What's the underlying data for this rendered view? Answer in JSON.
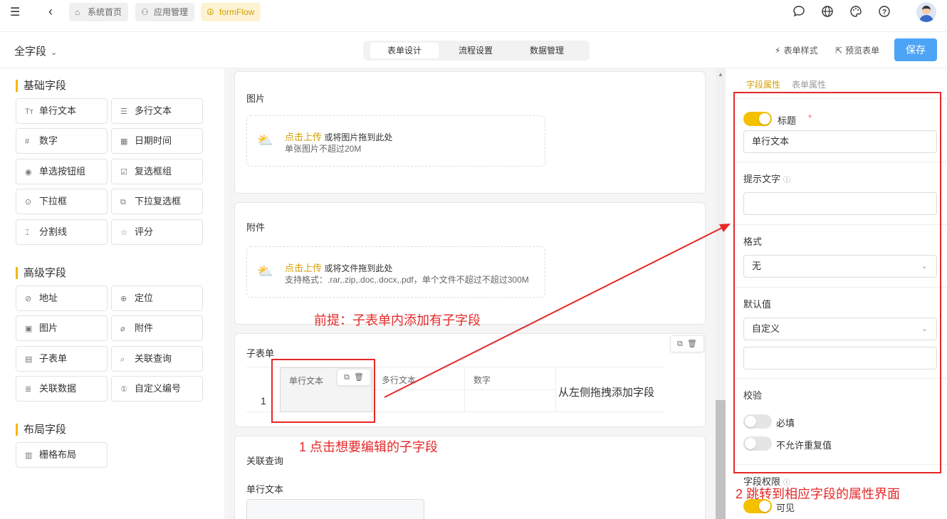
{
  "topbar": {
    "nav": [
      {
        "label": "系统首页",
        "icon": "home-icon",
        "glyph": "⌂"
      },
      {
        "label": "应用管理",
        "icon": "apps-icon",
        "glyph": "⚇"
      },
      {
        "label": "formFlow",
        "icon": "peace-icon",
        "glyph": "☮"
      }
    ],
    "right_icons": [
      "message-icon",
      "globe-icon",
      "palette-icon",
      "help-icon"
    ]
  },
  "subbar": {
    "field_select": "全字段",
    "tabs": [
      "表单设计",
      "流程设置",
      "数据管理"
    ],
    "active_tab": "表单设计",
    "form_style": "表单样式",
    "preview": "预览表单",
    "save": "保存"
  },
  "left": {
    "groups": [
      {
        "title": "基础字段",
        "items": [
          {
            "label": "单行文本",
            "glyph": "Tт"
          },
          {
            "label": "多行文本",
            "glyph": "☰"
          },
          {
            "label": "数字",
            "glyph": "#"
          },
          {
            "label": "日期时间",
            "glyph": "▦"
          },
          {
            "label": "单选按钮组",
            "glyph": "◉"
          },
          {
            "label": "复选框组",
            "glyph": "☑"
          },
          {
            "label": "下拉框",
            "glyph": "⊙"
          },
          {
            "label": "下拉复选框",
            "glyph": "⧉"
          },
          {
            "label": "分割线",
            "glyph": "⌶"
          },
          {
            "label": "评分",
            "glyph": "☆"
          }
        ]
      },
      {
        "title": "高级字段",
        "items": [
          {
            "label": "地址",
            "glyph": "⊘"
          },
          {
            "label": "定位",
            "glyph": "⊕"
          },
          {
            "label": "图片",
            "glyph": "▣"
          },
          {
            "label": "附件",
            "glyph": "⌀"
          },
          {
            "label": "子表单",
            "glyph": "▤"
          },
          {
            "label": "关联查询",
            "glyph": "⌕"
          },
          {
            "label": "关联数据",
            "glyph": "≣"
          },
          {
            "label": "自定义编号",
            "glyph": "①"
          }
        ]
      },
      {
        "title": "布局字段",
        "items": [
          {
            "label": "栅格布局",
            "glyph": "▥"
          }
        ]
      }
    ]
  },
  "canvas": {
    "image_card": {
      "label": "图片",
      "upload_link": "点击上传",
      "upload_text": "或将图片拖到此处",
      "limit": "单张图片不超过20M"
    },
    "attach_card": {
      "label": "附件",
      "upload_link": "点击上传",
      "upload_text": "或将文件拖到此处",
      "limit": "支持格式：.rar,.zip,.doc,.docx,.pdf，单个文件不超过不超过300M"
    },
    "subform_card": {
      "label": "子表单",
      "columns": [
        "单行文本",
        "多行文本",
        "数字"
      ],
      "row_number": "1",
      "drag_hint": "从左侧拖拽添加字段"
    },
    "lookup_card": {
      "label": "关联查询",
      "field_label": "单行文本"
    }
  },
  "right": {
    "tabs": [
      "字段属性",
      "表单属性"
    ],
    "active_tab": "字段属性",
    "title_label": "标题",
    "title_value": "单行文本",
    "hint_label": "提示文字",
    "format_label": "格式",
    "format_value": "无",
    "default_label": "默认值",
    "default_value": "自定义",
    "validation_label": "校验",
    "required_label": "必填",
    "no_dup_label": "不允许重复值",
    "permission_label": "字段权限",
    "visible_label": "可见",
    "toggle_color": "#f5c000"
  },
  "annotations": {
    "premise": "前提：子表单内添加有子字段",
    "step1": "1   点击想要编辑的子字段",
    "step2": "2   跳转到相应字段的属性界面",
    "color": "#e62828"
  }
}
